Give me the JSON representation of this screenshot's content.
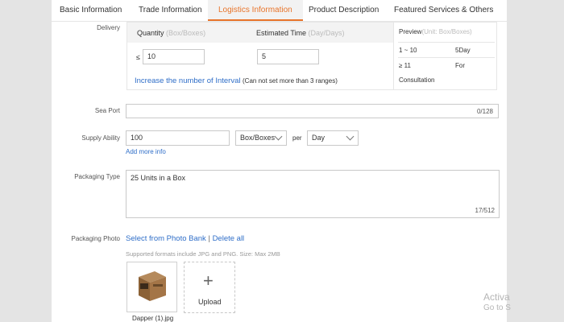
{
  "tabs": [
    {
      "label": "Basic Information"
    },
    {
      "label": "Trade Information"
    },
    {
      "label": "Logistics Information"
    },
    {
      "label": "Product Description"
    },
    {
      "label": "Featured Services & Others"
    }
  ],
  "delivery": {
    "label": "Delivery",
    "quantity_header": "Quantity",
    "quantity_unit": "(Box/Boxes)",
    "time_header": "Estimated Time",
    "time_unit": "(Day/Days)",
    "le_symbol": "≤",
    "quantity_value": "10",
    "time_value": "5",
    "add_interval_link": "Increase the number of Interval",
    "add_interval_note": "(Can not set more than 3 ranges)",
    "preview_title": "Preview",
    "preview_unit": "(Unit: Box/Boxes)",
    "preview_rows": [
      {
        "range": "1 ~ 10",
        "value": "5Day"
      },
      {
        "range": "≥ 11",
        "value": "For"
      }
    ],
    "preview_extra": "Consultation"
  },
  "sea_port": {
    "label": "Sea Port",
    "value": "",
    "counter": "0/128"
  },
  "supply": {
    "label": "Supply Ability",
    "value": "100",
    "unit": "Box/Boxes",
    "per": "per",
    "period": "Day",
    "add_more": "Add more info"
  },
  "packaging_type": {
    "label": "Packaging Type",
    "value": "25 Units in a Box",
    "counter": "17/512"
  },
  "packaging_photo": {
    "label": "Packaging Photo",
    "select_link": "Select from Photo Bank",
    "separator": "|",
    "delete_link": "Delete all",
    "note": "Supported formats include JPG and PNG. Size: Max 2MB",
    "file_name": "Dapper (1).jpg",
    "upload_label": "Upload"
  },
  "watermark": {
    "line1": "Activa",
    "line2": "Go to S"
  }
}
